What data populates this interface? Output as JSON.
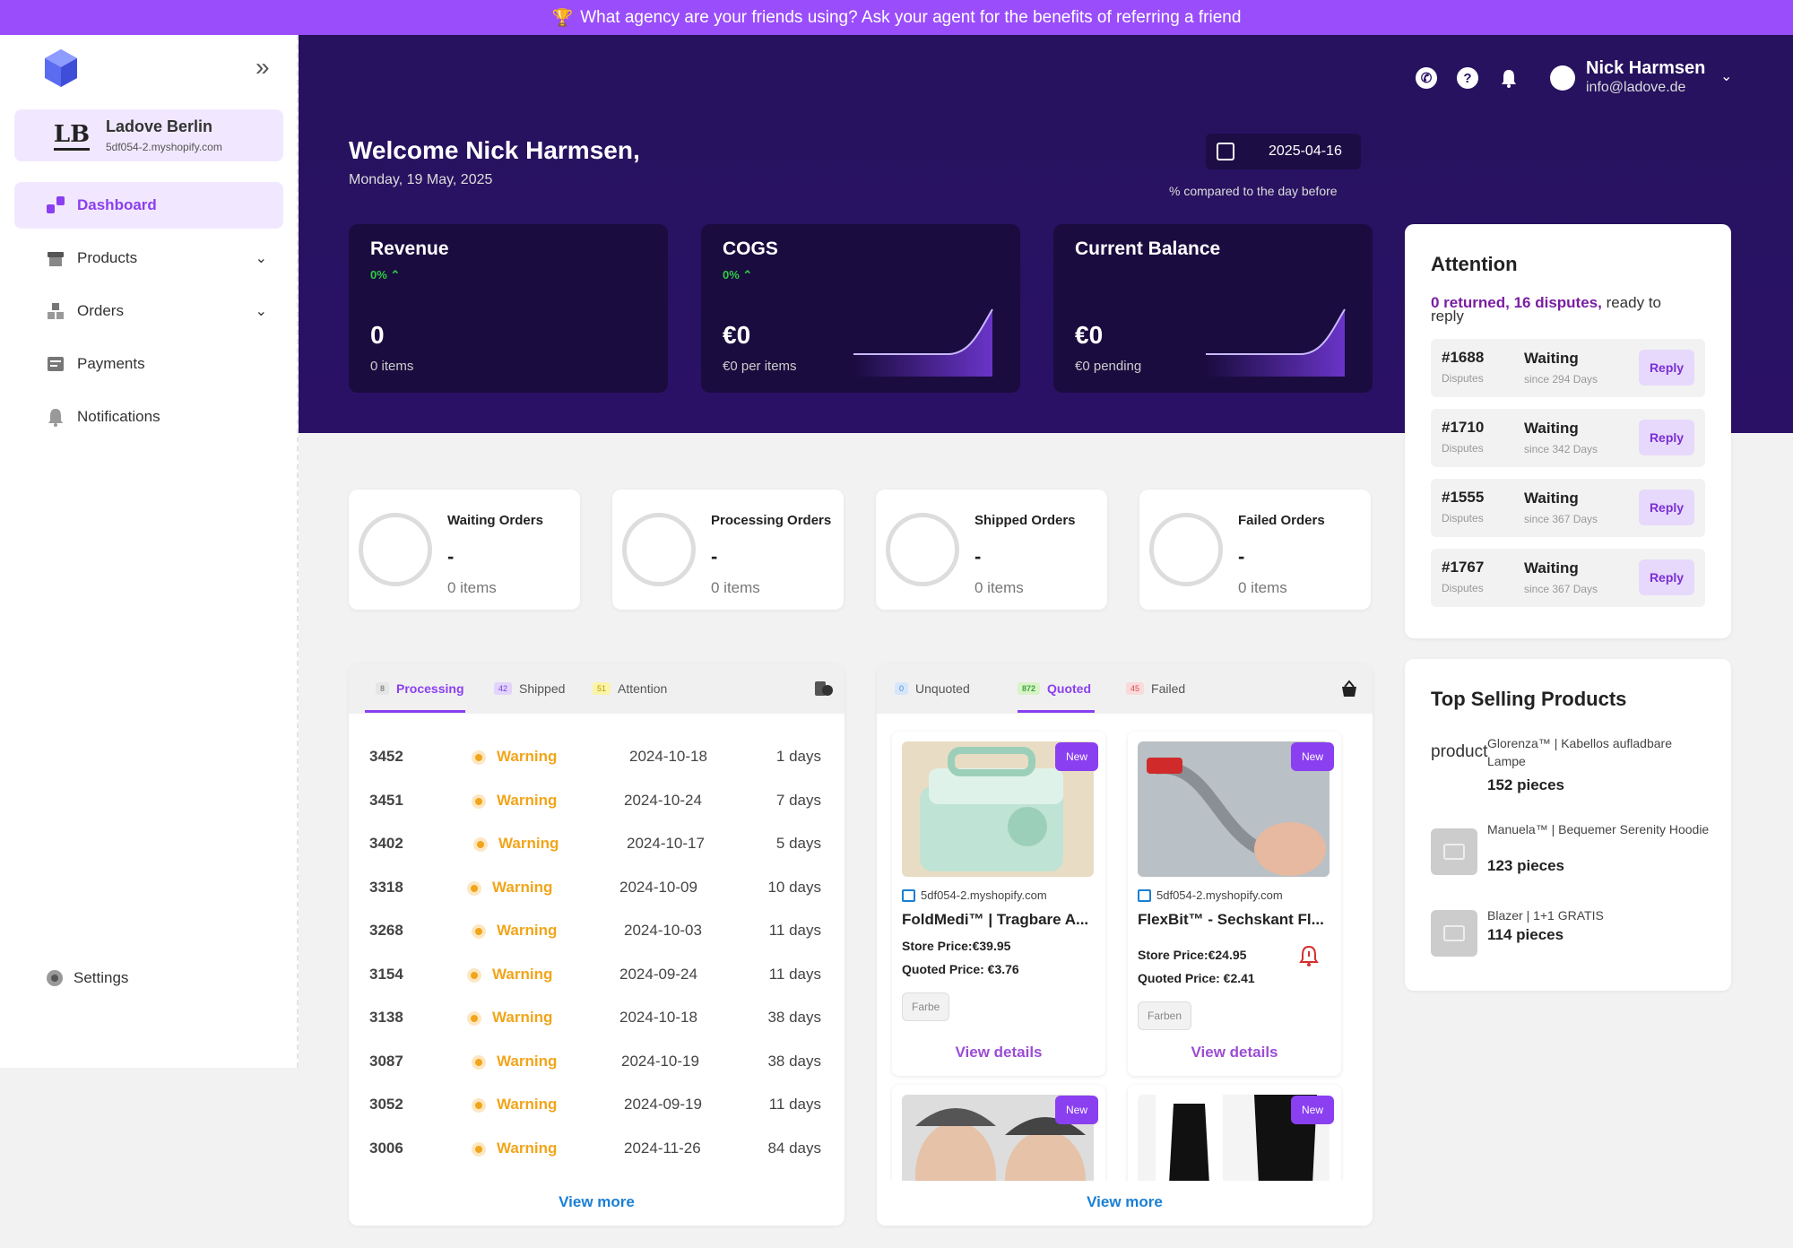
{
  "banner": {
    "icon": "trophy-icon",
    "text": "What agency are your friends using? Ask your agent for the benefits of referring a friend"
  },
  "sidebar": {
    "store_name": "Ladove Berlin",
    "store_url": "5df054-2.myshopify.com",
    "store_monogram": "LB",
    "items": [
      {
        "label": "Dashboard",
        "icon": "dashboard-icon",
        "active": true
      },
      {
        "label": "Products",
        "icon": "products-icon",
        "expandable": true
      },
      {
        "label": "Orders",
        "icon": "orders-icon",
        "expandable": true
      },
      {
        "label": "Payments",
        "icon": "payments-icon"
      },
      {
        "label": "Notifications",
        "icon": "notifications-icon"
      }
    ],
    "settings_label": "Settings"
  },
  "header": {
    "user_name": "Nick Harmsen",
    "user_email": "info@ladove.de",
    "welcome": "Welcome Nick Harmsen,",
    "date": "Monday, 19 May, 2025",
    "selected_date": "2025-04-16",
    "compare_note": "% compared to the day before"
  },
  "stats": [
    {
      "title": "Revenue",
      "change": "0%",
      "value": "0",
      "sub": "0 items"
    },
    {
      "title": "COGS",
      "change": "0%",
      "value": "€0",
      "sub": "€0 per items"
    },
    {
      "title": "Current Balance",
      "change": "",
      "value": "€0",
      "sub": "€0 pending"
    }
  ],
  "order_cards": [
    {
      "title": "Waiting Orders",
      "value": "-",
      "sub": "0 items"
    },
    {
      "title": "Processing Orders",
      "value": "-",
      "sub": "0 items"
    },
    {
      "title": "Shipped Orders",
      "value": "-",
      "sub": "0 items"
    },
    {
      "title": "Failed Orders",
      "value": "-",
      "sub": "0 items"
    }
  ],
  "orders_panel": {
    "tabs": [
      {
        "label": "Processing",
        "count": "8",
        "badge_color": "#e6e6e6",
        "count_color": "#888"
      },
      {
        "label": "Shipped",
        "count": "42",
        "badge_color": "#e2d4fb",
        "count_color": "#7a3fe0"
      },
      {
        "label": "Attention",
        "count": "51",
        "badge_color": "#fbf3a8",
        "count_color": "#b8a200"
      }
    ],
    "rows": [
      {
        "id": "3452",
        "status": "Warning",
        "date": "2024-10-18",
        "days": "1 days"
      },
      {
        "id": "3451",
        "status": "Warning",
        "date": "2024-10-24",
        "days": "7 days"
      },
      {
        "id": "3402",
        "status": "Warning",
        "date": "2024-10-17",
        "days": "5 days"
      },
      {
        "id": "3318",
        "status": "Warning",
        "date": "2024-10-09",
        "days": "10 days"
      },
      {
        "id": "3268",
        "status": "Warning",
        "date": "2024-10-03",
        "days": "11 days"
      },
      {
        "id": "3154",
        "status": "Warning",
        "date": "2024-09-24",
        "days": "11 days"
      },
      {
        "id": "3138",
        "status": "Warning",
        "date": "2024-10-18",
        "days": "38 days"
      },
      {
        "id": "3087",
        "status": "Warning",
        "date": "2024-10-19",
        "days": "38 days"
      },
      {
        "id": "3052",
        "status": "Warning",
        "date": "2024-09-19",
        "days": "11 days"
      },
      {
        "id": "3006",
        "status": "Warning",
        "date": "2024-11-26",
        "days": "84 days"
      }
    ],
    "view_more": "View more"
  },
  "quotes_panel": {
    "tabs": [
      {
        "label": "Unquoted",
        "count": "0",
        "badge_color": "#d6e6fb",
        "count_color": "#4a8ad4"
      },
      {
        "label": "Quoted",
        "count": "872",
        "badge_color": "#d8f3c8",
        "count_color": "#3aa63a"
      },
      {
        "label": "Failed",
        "count": "45",
        "badge_color": "#fbdada",
        "count_color": "#d45050"
      }
    ],
    "products": [
      {
        "badge": "New",
        "shop": "5df054-2.myshopify.com",
        "title": "FoldMedi™ | Tragbare A...",
        "store_price": "Store Price:€39.95",
        "quoted_price": "Quoted Price: €3.76",
        "option": "Farbe",
        "link": "View details"
      },
      {
        "badge": "New",
        "shop": "5df054-2.myshopify.com",
        "title": "FlexBit™ - Sechskant Fl...",
        "store_price": "Store Price:€24.95",
        "quoted_price": "Quoted Price: €2.41",
        "option": "Farben",
        "link": "View details"
      },
      {
        "badge": "New"
      },
      {
        "badge": "New"
      }
    ],
    "view_more": "View more"
  },
  "attention": {
    "title": "Attention",
    "highlight": "0 returned, 16 disputes,",
    "rest": " ready to reply",
    "disputes": [
      {
        "id": "#1688",
        "category": "Disputes",
        "status": "Waiting",
        "since": "since 294 Days",
        "action": "Reply"
      },
      {
        "id": "#1710",
        "category": "Disputes",
        "status": "Waiting",
        "since": "since 342 Days",
        "action": "Reply"
      },
      {
        "id": "#1555",
        "category": "Disputes",
        "status": "Waiting",
        "since": "since 367 Days",
        "action": "Reply"
      },
      {
        "id": "#1767",
        "category": "Disputes",
        "status": "Waiting",
        "since": "since 367 Days",
        "action": "Reply"
      }
    ]
  },
  "top_selling": {
    "title": "Top Selling Products",
    "items": [
      {
        "thumb_alt": "product",
        "name": "Glorenza™ | Kabellos aufladbare Lampe",
        "qty": "152 pieces"
      },
      {
        "name": "Manuela™ | Bequemer Serenity Hoodie",
        "qty": "123 pieces"
      },
      {
        "name": "Blazer | 1+1 GRATIS",
        "qty": "114 pieces"
      }
    ]
  },
  "colors": {
    "accent": "#8a3ff0",
    "hero_bg": "#26125e",
    "banner": "#9a4dfb",
    "warning": "#f2a51a",
    "link": "#1a7fd4"
  }
}
